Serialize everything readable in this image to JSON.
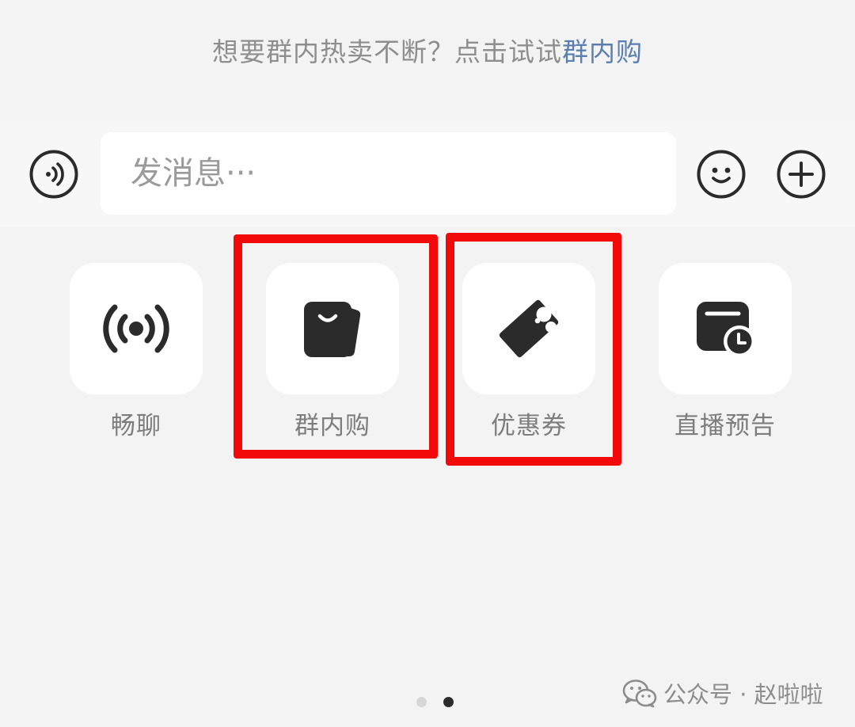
{
  "promo": {
    "text": "想要群内热卖不断？点击试试",
    "link": "群内购"
  },
  "input_bar": {
    "voice_icon": "voice-icon",
    "placeholder": "发消息···",
    "emoji_icon": "emoji-icon",
    "plus_icon": "plus-icon"
  },
  "tools": [
    {
      "label": "畅聊",
      "icon": "broadcast-icon"
    },
    {
      "label": "群内购",
      "icon": "shopping-bag-icon"
    },
    {
      "label": "优惠券",
      "icon": "coupon-icon"
    },
    {
      "label": "直播预告",
      "icon": "live-schedule-icon"
    }
  ],
  "pager": {
    "current_page": 2,
    "total_pages": 2
  },
  "watermark": {
    "text": "公众号 · 赵啦啦",
    "icon": "wechat-icon"
  },
  "colors": {
    "background": "#f3f3f3",
    "link": "#5b7eb0",
    "highlight": "#f20a0a",
    "icon": "#2b2b2b",
    "label": "#7d7d7d"
  }
}
